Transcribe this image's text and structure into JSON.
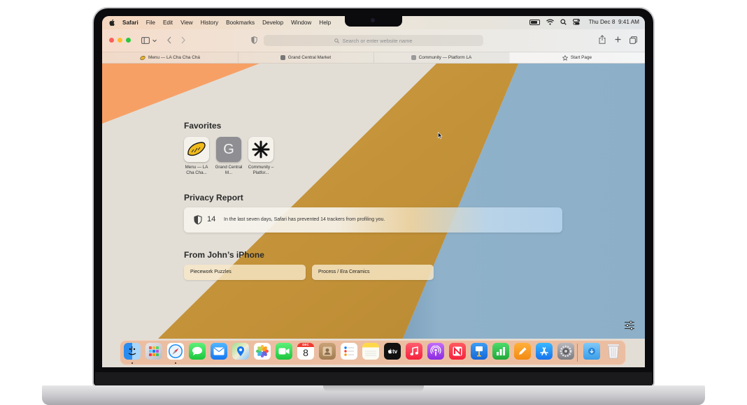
{
  "menubar": {
    "app_name": "Safari",
    "menus": [
      "File",
      "Edit",
      "View",
      "History",
      "Bookmarks",
      "Develop",
      "Window",
      "Help"
    ],
    "datetime": "Thu Dec 8  9:41 AM"
  },
  "toolbar": {
    "search_placeholder": "Search or enter website name"
  },
  "tabs": [
    {
      "label": "Menu — LA Cha Cha Chá",
      "active": false
    },
    {
      "label": "Grand Central Market",
      "active": false
    },
    {
      "label": "Community — Platform LA",
      "active": false
    },
    {
      "label": "Start Page",
      "active": true
    }
  ],
  "start_page": {
    "favorites_title": "Favorites",
    "favorites": [
      {
        "label": "Menu — LA Cha Cha...",
        "glyph": ""
      },
      {
        "label": "Grand Central M...",
        "glyph": "G"
      },
      {
        "label": "Community – Platfor...",
        "glyph": ""
      }
    ],
    "privacy_title": "Privacy Report",
    "privacy_count": "14",
    "privacy_message": "In the last seven days, Safari has prevented 14 trackers from profiling you.",
    "iphone_title": "From John’s iPhone",
    "iphone_items": [
      "Piecework Puzzles",
      "Process / Era Ceramics"
    ]
  },
  "dock": {
    "calendar_month": "DEC",
    "calendar_day": "8",
    "tv_label": "tv",
    "apps": [
      "finder-icon",
      "launchpad-icon",
      "safari-icon",
      "messages-icon",
      "mail-icon",
      "maps-icon",
      "photos-icon",
      "facetime-icon",
      "calendar-icon",
      "contacts-icon",
      "reminders-icon",
      "notes-icon",
      "tv-icon",
      "music-icon",
      "podcasts-icon",
      "news-icon",
      "keynote-icon",
      "numbers-icon",
      "pages-icon",
      "app-store-icon",
      "system-settings-icon",
      "downloads-icon",
      "trash-icon"
    ]
  },
  "colors": {
    "wallpaper_orange": "#f7a066",
    "wallpaper_beige": "#e2ded6",
    "wallpaper_mustard": "#c9963a",
    "wallpaper_blue": "#8eb0c9"
  }
}
